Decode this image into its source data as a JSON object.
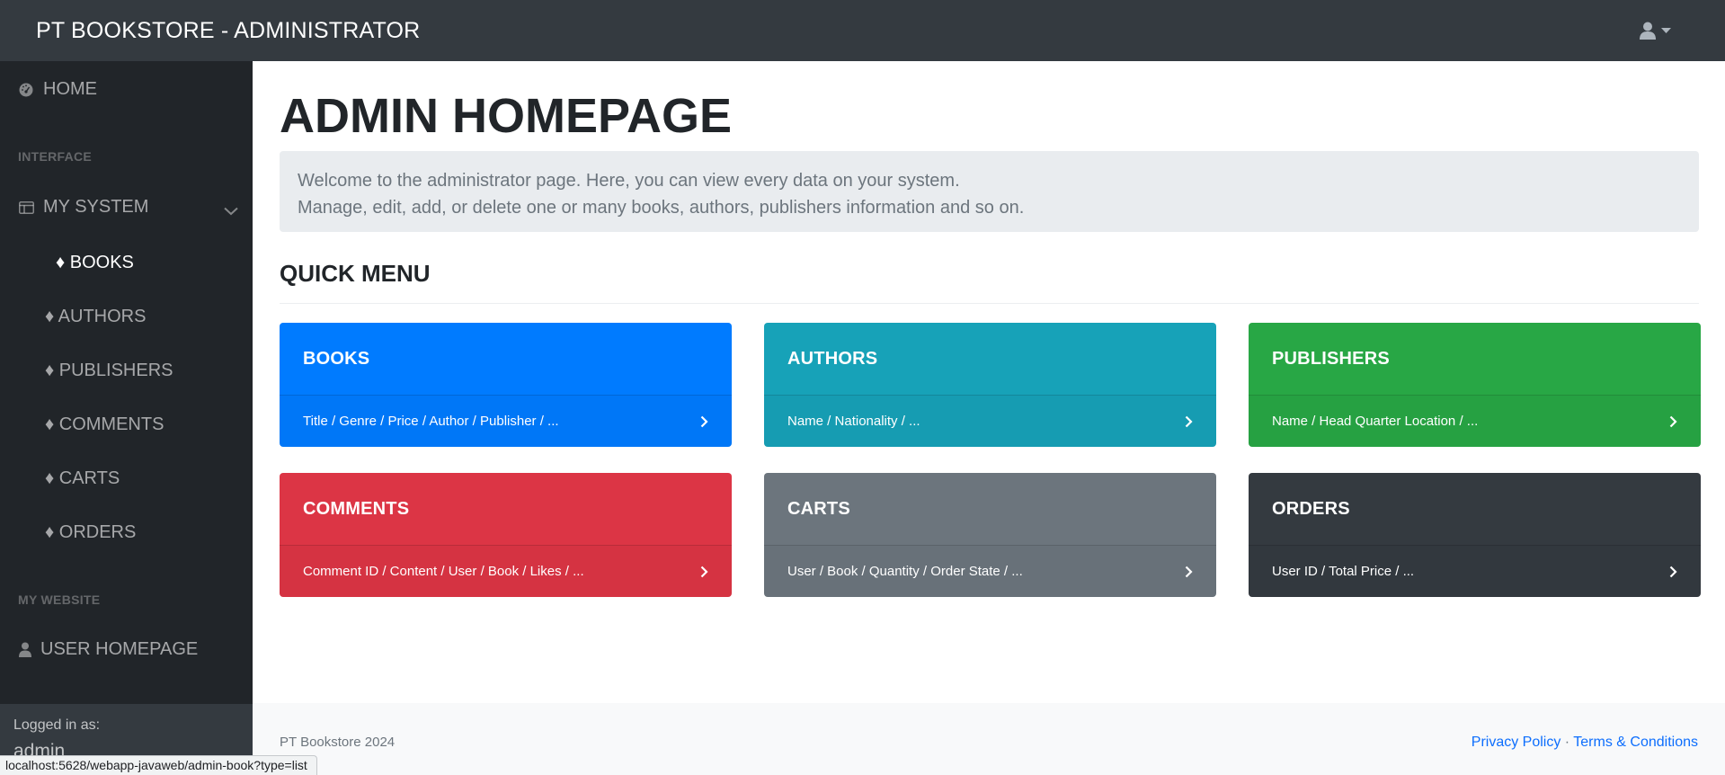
{
  "app": {
    "brand": "PT BOOKSTORE - ADMINISTRATOR"
  },
  "sidebar": {
    "home": "HOME",
    "interface_heading": "INTERFACE",
    "my_system": "MY SYSTEM",
    "sub_items": [
      "♦ BOOKS",
      "♦ AUTHORS",
      "♦ PUBLISHERS",
      "♦ COMMENTS",
      "♦ CARTS",
      "♦ ORDERS"
    ],
    "active_item": "BOOKS",
    "website_heading": "MY WEBSITE",
    "user_homepage": "USER HOMEPAGE",
    "footer_label": "Logged in as:",
    "footer_user": "admin"
  },
  "main": {
    "title": "ADMIN HOMEPAGE",
    "welcome_line1": "Welcome to the administrator page. Here, you can view every data on your system.",
    "welcome_line2": "Manage, edit, add, or delete one or many books, authors, publishers information and so on.",
    "quick_menu_title": "QUICK MENU",
    "cards": [
      {
        "title": "BOOKS",
        "desc": "Title / Genre / Price / Author / Publisher / ...",
        "color": "#007bff"
      },
      {
        "title": "AUTHORS",
        "desc": "Name / Nationality / ...",
        "color": "#17a2b8"
      },
      {
        "title": "PUBLISHERS",
        "desc": "Name / Head Quarter Location / ...",
        "color": "#28a745"
      },
      {
        "title": "COMMENTS",
        "desc": "Comment ID / Content / User / Book / Likes / ...",
        "color": "#dc3545"
      },
      {
        "title": "CARTS",
        "desc": "User / Book / Quantity / Order State / ...",
        "color": "#6c757d"
      },
      {
        "title": "ORDERS",
        "desc": "User ID / Total Price / ...",
        "color": "#343a40"
      }
    ]
  },
  "footer": {
    "copyright": "PT Bookstore 2024",
    "privacy": "Privacy Policy",
    "separator": "·",
    "terms": "Terms & Conditions"
  },
  "status_bar": {
    "url": "localhost:5628/webapp-javaweb/admin-book?type=list"
  },
  "icons": {
    "home": "dashboard-icon",
    "my_system": "columns-icon",
    "user_homepage": "user-icon",
    "topbar_user": "user-icon",
    "card_arrow": "chevron-right-icon"
  }
}
